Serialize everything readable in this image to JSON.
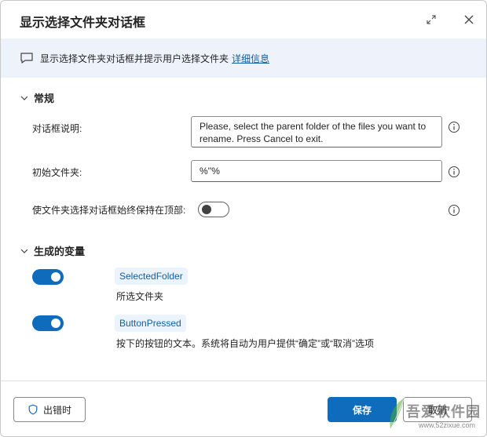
{
  "dialog": {
    "title": "显示选择文件夹对话框"
  },
  "banner": {
    "text": "显示选择文件夹对话框并提示用户选择文件夹",
    "link": "详细信息"
  },
  "general": {
    "header": "常规",
    "fields": {
      "dialog_desc_label": "对话框说明:",
      "dialog_desc_value_line1": "Please, select the parent folder of the files you want to",
      "dialog_desc_value_line2": "rename. Press Cancel to exit.",
      "initial_folder_label": "初始文件夹:",
      "initial_folder_value": "%''%",
      "keep_on_top_label": "使文件夹选择对话框始终保持在顶部:"
    },
    "keep_on_top_enabled": false
  },
  "variables": {
    "header": "生成的变量",
    "items": [
      {
        "name": "SelectedFolder",
        "description": "所选文件夹",
        "enabled": true
      },
      {
        "name": "ButtonPressed",
        "description": "按下的按钮的文本。系统将自动为用户提供“确定”或“取消”选项",
        "enabled": true
      }
    ]
  },
  "footer": {
    "on_error_label": "出错时",
    "save_label": "保存",
    "cancel_label": "取消"
  },
  "watermark": {
    "brand": "吾爱软件园",
    "url": "www.52zixue.com"
  },
  "colors": {
    "accent": "#0f6cbd",
    "banner_bg": "#eef3fb",
    "chip_bg": "#ebf3fc",
    "link": "#115ea3"
  }
}
